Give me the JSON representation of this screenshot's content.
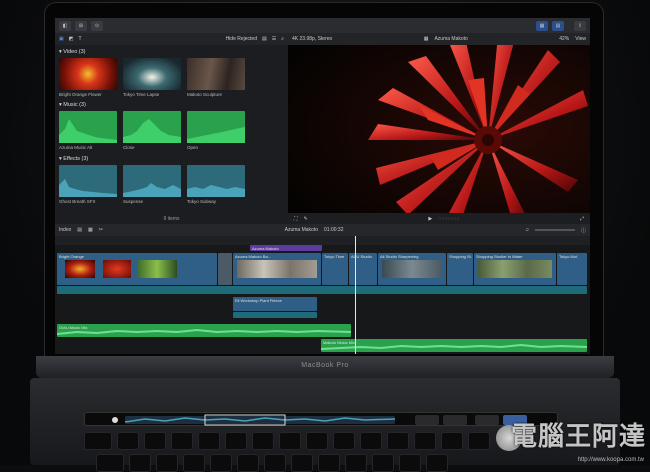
{
  "device": {
    "hinge_label": "MacBook Pro"
  },
  "toolbar": {
    "buttons": [
      "◧",
      "⊞",
      "⊙"
    ],
    "right_buttons": [
      "▦",
      "▤"
    ]
  },
  "browser": {
    "filter": "Hide Rejected",
    "format_label": "4K 23.98p, Stereo",
    "sections": [
      {
        "label": "Video (3)",
        "clips": [
          "Bright Orange Flower",
          "Tokyo Time Lapse",
          "Makoto Sculpture"
        ]
      },
      {
        "label": "Music (3)",
        "clips": [
          "Azuma Music Alt",
          "Close",
          "Open"
        ]
      },
      {
        "label": "Effects (3)",
        "clips": [
          "Ghost Breath SFX",
          "Suspense",
          "Tokyo Subway"
        ]
      }
    ],
    "items_count": "9 items"
  },
  "viewer": {
    "title": "Azuma Makoto",
    "zoom": "42%",
    "view_label": "View"
  },
  "timeline": {
    "index_label": "Index",
    "project_name": "Azuma Makoto",
    "duration": "01:00:32",
    "primary_clips": [
      "Bright Orange",
      "Azuma Makoto Ba...",
      "Tokyo Time",
      "ACU Studio",
      "All Studio Sharpening",
      "Shopping St.",
      "Shopping Stroller in Water",
      "Tokyo Mot"
    ],
    "title_clip": "Azuma Makoto",
    "connected_clip": "Ell Workshop Plant Fleece",
    "music_clip_1": "Ochu Music Mix",
    "music_clip_2": "Makoto Music Mix"
  },
  "watermark": {
    "text": "電腦王阿達",
    "url": "http://www.koopa.com.tw"
  },
  "colors": {
    "video_clip": "#2f5f86",
    "audio_clip": "#2aa24d",
    "title_clip": "#5b3da0",
    "accent": "#2a4f8c"
  }
}
